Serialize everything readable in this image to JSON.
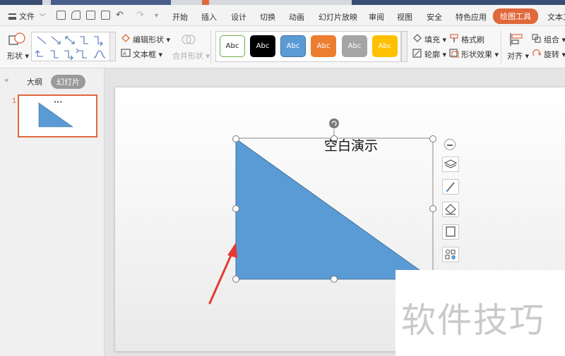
{
  "menu": {
    "file_label": "文件",
    "tabs": [
      "开始",
      "插入",
      "设计",
      "切换",
      "动画",
      "幻灯片放映",
      "审阅",
      "视图",
      "安全",
      "特色应用",
      "绘图工具",
      "文本工"
    ],
    "active_tab": "绘图工具"
  },
  "ribbon": {
    "shape_label": "形状",
    "edit_shape_label": "编辑形状",
    "textbox_label": "文本框",
    "merge_shape_label": "合并形状",
    "style_samples": [
      {
        "text": "Abc",
        "bg": "#ffffff",
        "fg": "#222222",
        "border": "#70ad47"
      },
      {
        "text": "Abc",
        "bg": "#000000",
        "fg": "#ffffff",
        "border": "#000000"
      },
      {
        "text": "Abc",
        "bg": "#5b9bd5",
        "fg": "#ffffff",
        "border": "#41719c"
      },
      {
        "text": "Abc",
        "bg": "#ed7d31",
        "fg": "#ffffff",
        "border": "#ed7d31"
      },
      {
        "text": "Abc",
        "bg": "#a5a5a5",
        "fg": "#ffffff",
        "border": "#a5a5a5"
      },
      {
        "text": "Abc",
        "bg": "#ffc000",
        "fg": "#ffffff",
        "border": "#ffc000"
      }
    ],
    "fill_label": "填充",
    "format_painter_label": "格式刷",
    "outline_label": "轮廓",
    "shape_effects_label": "形状效果",
    "align_label": "对齐",
    "group_label": "组合",
    "rotate_label": "旋转"
  },
  "left_panel": {
    "outline_tab": "大纲",
    "slides_tab": "幻灯片",
    "slide_number": "1",
    "thumb_title": "•••"
  },
  "slide": {
    "title": "空白演示"
  },
  "watermark": {
    "text": "软件技巧"
  },
  "colors": {
    "accent": "#e0683a",
    "shape_fill": "#5b9bd5",
    "annotation_arrow": "#e53935"
  }
}
